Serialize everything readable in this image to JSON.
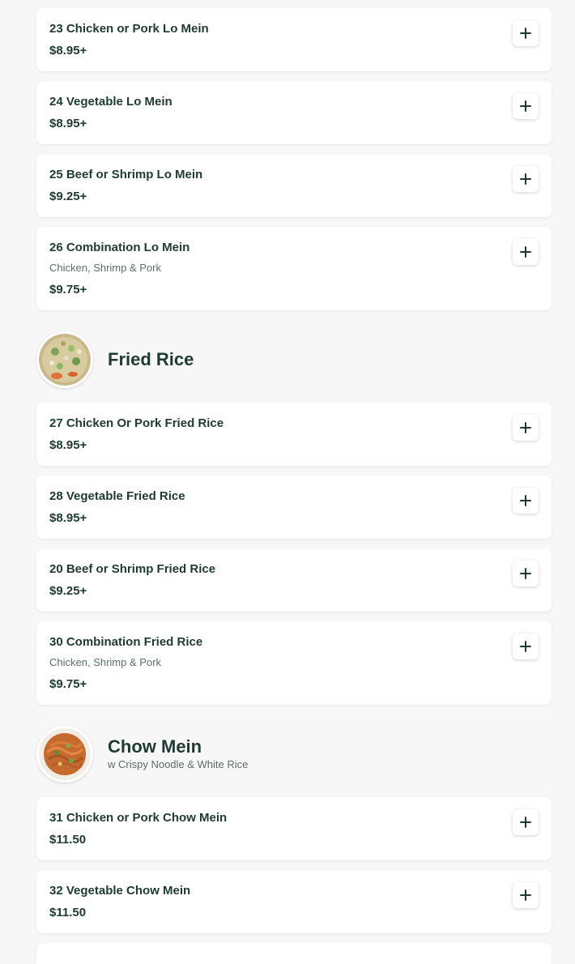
{
  "lo_mein_items": [
    {
      "title": "23 Chicken or Pork Lo Mein",
      "desc": "",
      "price": "$8.95+"
    },
    {
      "title": "24 Vegetable Lo Mein",
      "desc": "",
      "price": "$8.95+"
    },
    {
      "title": "25 Beef or Shrimp Lo Mein",
      "desc": "",
      "price": "$9.25+"
    },
    {
      "title": "26 Combination Lo Mein",
      "desc": "Chicken, Shrimp & Pork",
      "price": "$9.75+"
    }
  ],
  "fried_rice": {
    "title": "Fried Rice",
    "items": [
      {
        "title": "27 Chicken Or Pork Fried Rice",
        "desc": "",
        "price": "$8.95+"
      },
      {
        "title": "28 Vegetable Fried Rice",
        "desc": "",
        "price": "$8.95+"
      },
      {
        "title": "20 Beef or Shrimp Fried Rice",
        "desc": "",
        "price": "$9.25+"
      },
      {
        "title": "30 Combination Fried Rice",
        "desc": "Chicken, Shrimp & Pork",
        "price": "$9.75+"
      }
    ]
  },
  "chow_mein": {
    "title": "Chow Mein",
    "subtitle": "w Crispy Noodle & White Rice",
    "items": [
      {
        "title": "31 Chicken or Pork Chow Mein",
        "desc": "",
        "price": "$11.50"
      },
      {
        "title": "32 Vegetable Chow Mein",
        "desc": "",
        "price": "$11.50"
      }
    ]
  },
  "icons": {
    "add": "plus-icon"
  },
  "colors": {
    "text": "#1e3a33",
    "muted": "#5e6d69",
    "background": "#f7f7f7",
    "card": "#ffffff"
  }
}
